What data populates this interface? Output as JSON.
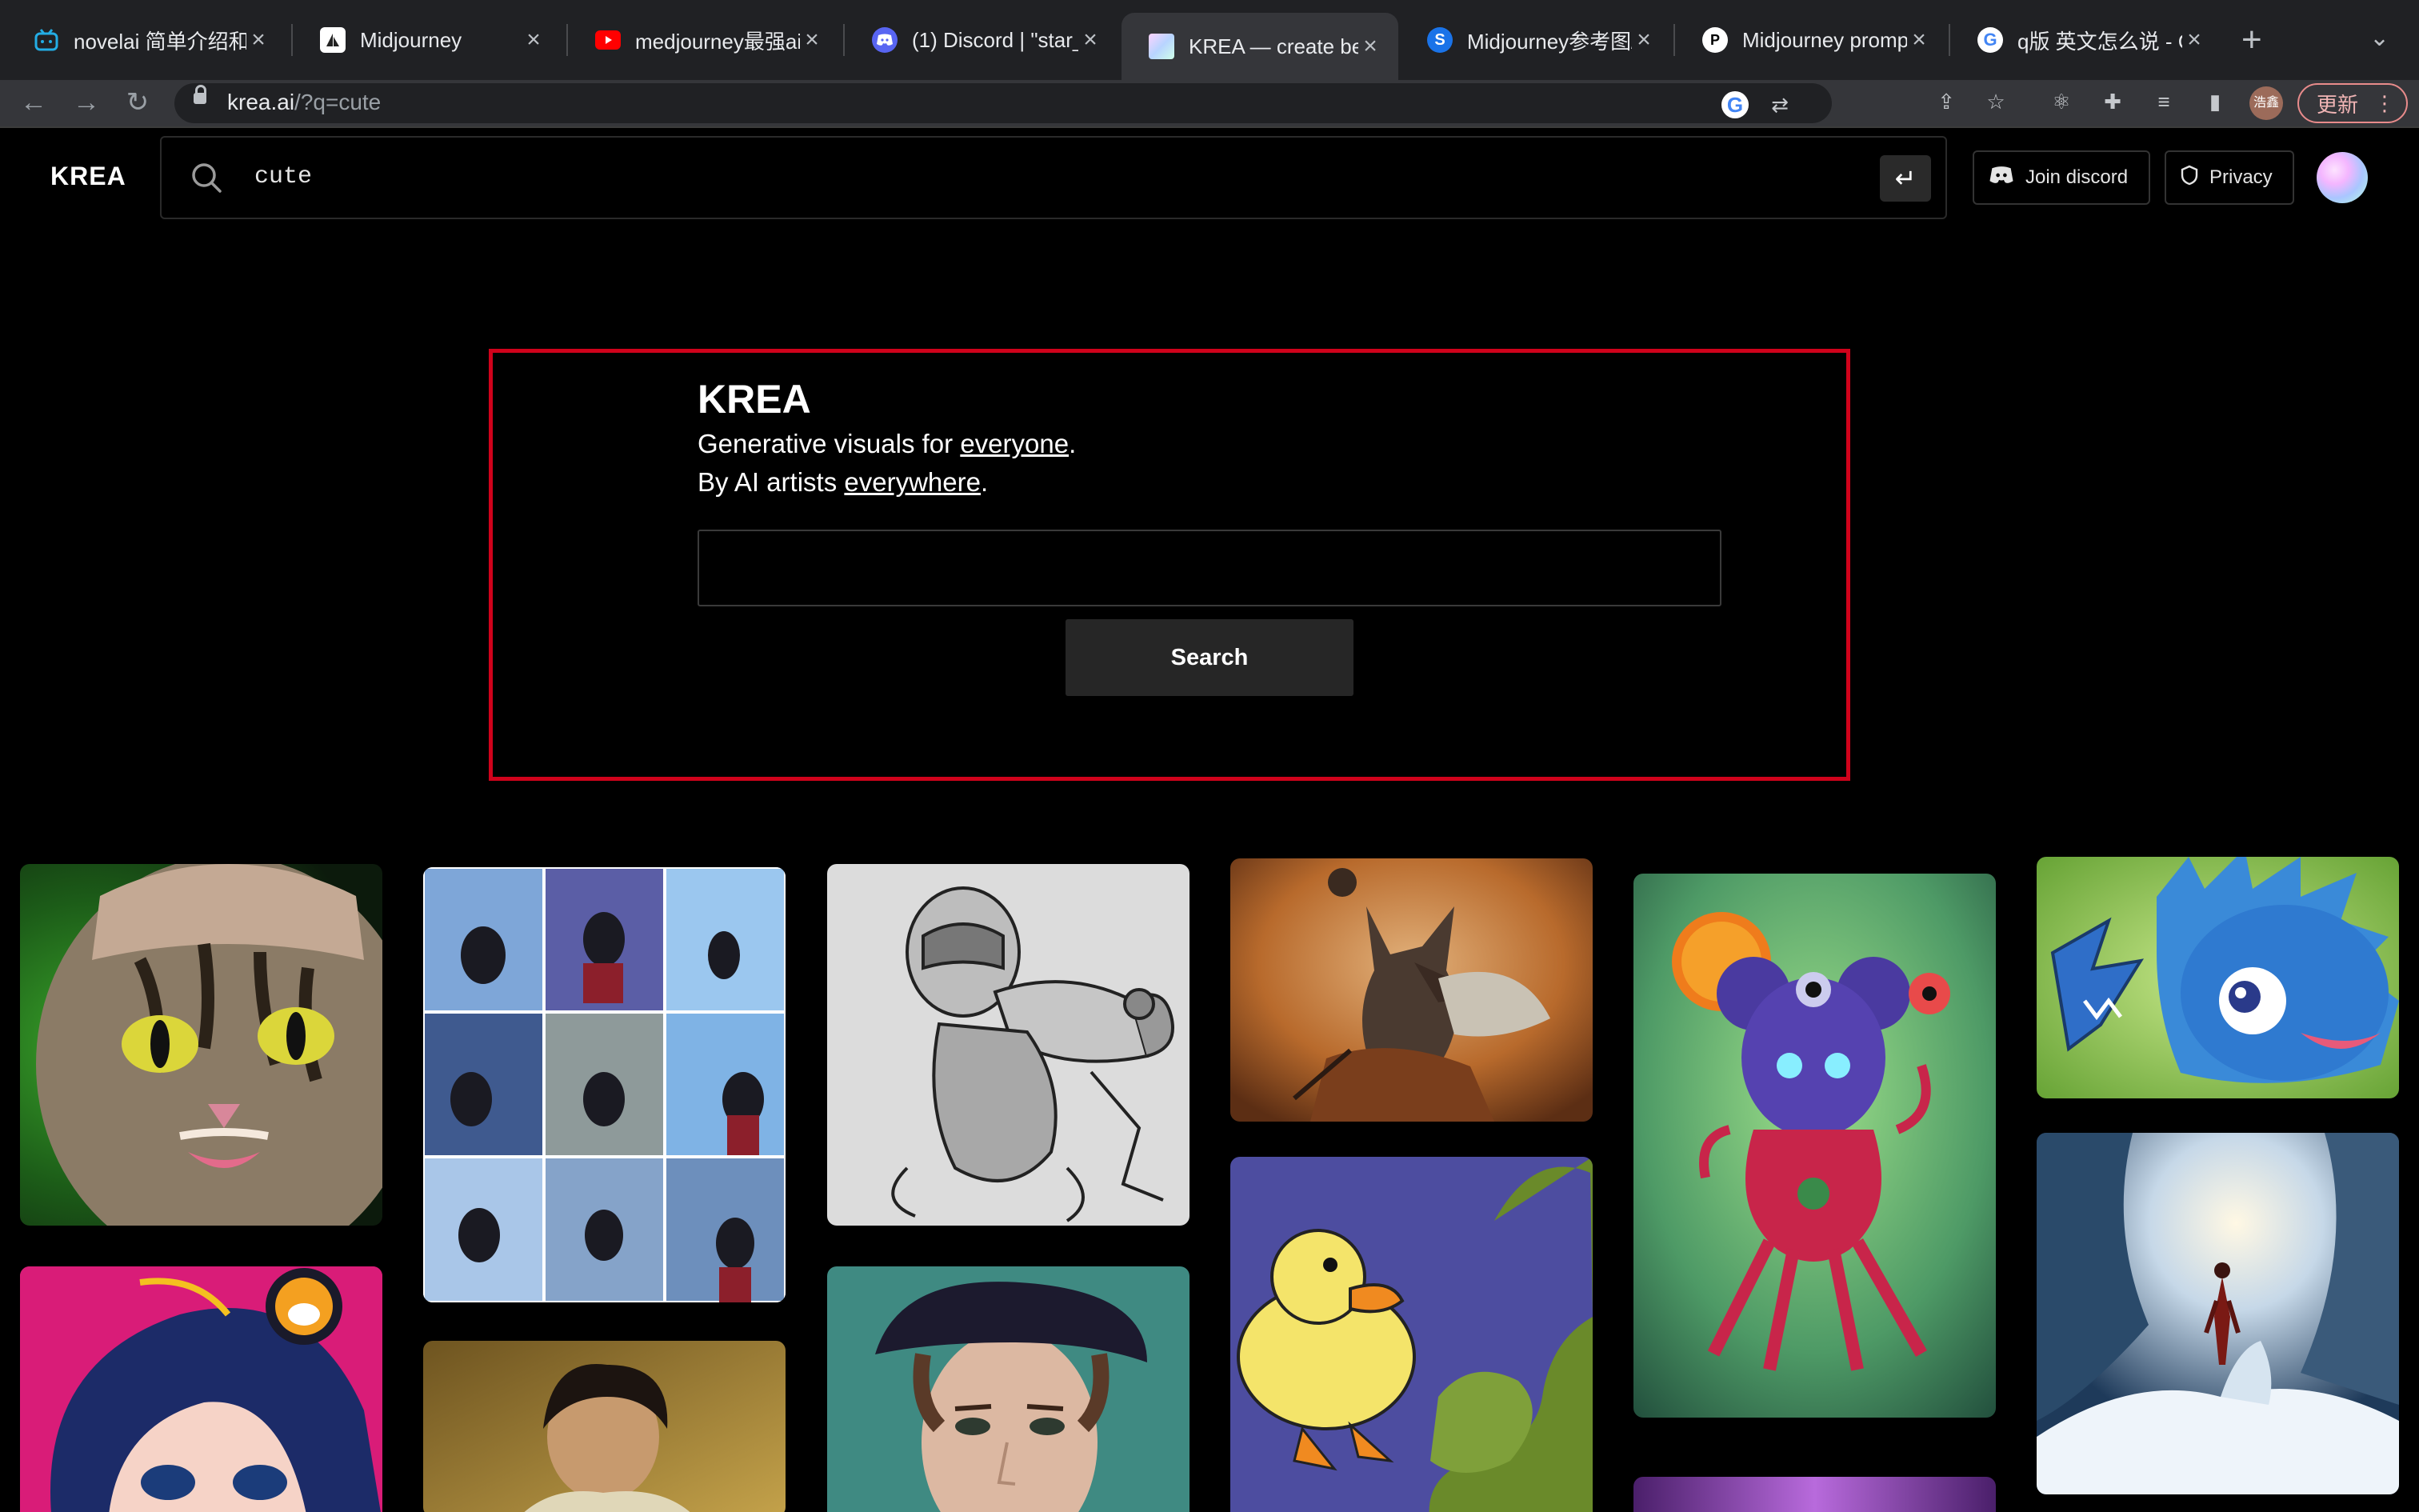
{
  "browser": {
    "tabs": [
      {
        "title": "novelai 简单介绍和I",
        "favicon": "bilibili-icon"
      },
      {
        "title": "Midjourney",
        "favicon": "midjourney-icon"
      },
      {
        "title": "medjourney最强ai绘",
        "favicon": "youtube-icon"
      },
      {
        "title": "(1) Discord | \"star_",
        "favicon": "discord-icon"
      },
      {
        "title": "KREA — create bet",
        "favicon": "krea-icon",
        "active": true
      },
      {
        "title": "Midjourney参考图/",
        "favicon": "s-icon"
      },
      {
        "title": "Midjourney prompt",
        "favicon": "github-icon"
      },
      {
        "title": "q版 英文怎么说 - Go",
        "favicon": "google-icon"
      }
    ],
    "url_host": "krea.ai",
    "url_path": "/?q=cute",
    "profile_label": "浩鑫",
    "update_label": "更新"
  },
  "header": {
    "logo": "KREA",
    "search_query": "cute",
    "join_discord": "Join discord",
    "privacy": "Privacy"
  },
  "hero": {
    "title": "KREA",
    "line1_prefix": "Generative visuals for ",
    "line1_link": "everyone",
    "line1_suffix": ".",
    "line2_prefix": "By AI artists ",
    "line2_link": "everywhere",
    "line2_suffix": ".",
    "search_value": "",
    "search_button": "Search"
  },
  "colors": {
    "highlight_frame": "#d0021b",
    "page_bg": "#000000"
  },
  "gallery": [
    {
      "name": "gallery-image-cat"
    },
    {
      "name": "gallery-image-anime-grid"
    },
    {
      "name": "gallery-image-robot-sketch"
    },
    {
      "name": "gallery-image-fox-warrior"
    },
    {
      "name": "gallery-image-creature"
    },
    {
      "name": "gallery-image-blue-monster"
    },
    {
      "name": "gallery-image-anime-girl"
    },
    {
      "name": "gallery-image-boy-painting"
    },
    {
      "name": "gallery-image-woman-beret"
    },
    {
      "name": "gallery-image-duck"
    },
    {
      "name": "gallery-image-snow-cave"
    },
    {
      "name": "gallery-image-purple"
    }
  ]
}
